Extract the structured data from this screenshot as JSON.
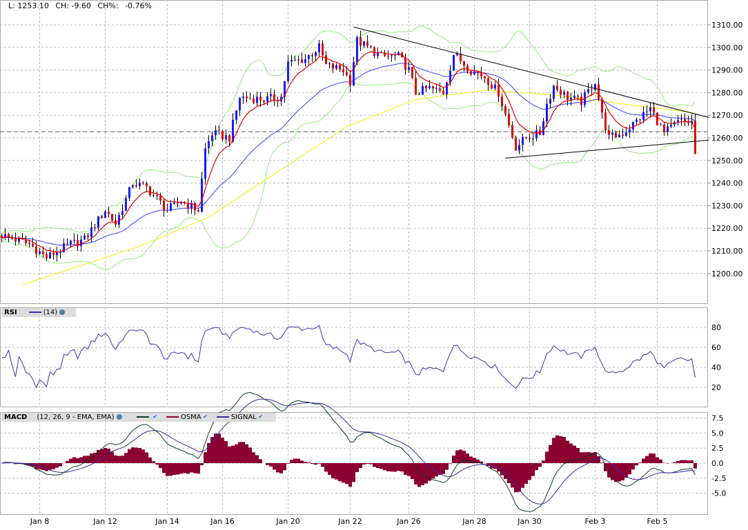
{
  "header": {
    "last": "L: 1253.10",
    "change": "CH: -9.60",
    "change_pct_label": "CH%:",
    "change_pct": "-0.76%"
  },
  "rsi_legend": {
    "name": "RSI",
    "param": "(14)"
  },
  "macd_legend": {
    "name": "MACD",
    "param": "(12, 26, 9 - EMA, EMA)",
    "osma": "OSMA",
    "signal": "SIGNAL"
  },
  "colors": {
    "up": "#1a1aff",
    "down": "#e00000",
    "ema_fast": "#e00000",
    "ema_slow": "#3b3bff",
    "bollinger": "#8cf07a",
    "sma_long": "#f2f23a",
    "rsi": "#4a2bb0",
    "macd": "#0d3b2a",
    "signal": "#3a2aa0",
    "osma": "#8b0030",
    "trend": "#000000"
  },
  "chart_data": {
    "type": "candlestick",
    "x_unit": "bar index",
    "price_axis": {
      "ticks": [
        "1310.00",
        "1300.00",
        "1290.00",
        "1280.00",
        "1270.00",
        "1260.00",
        "1250.00",
        "1240.00",
        "1230.00",
        "1220.00",
        "1210.00",
        "1200.00"
      ],
      "range": [
        1190,
        1316
      ]
    },
    "previous_close": 1262.7,
    "price_keypoints": [
      [
        0,
        1217
      ],
      [
        8,
        1213
      ],
      [
        13,
        1207
      ],
      [
        20,
        1213
      ],
      [
        24,
        1215
      ],
      [
        30,
        1228
      ],
      [
        33,
        1222
      ],
      [
        38,
        1240
      ],
      [
        42,
        1238
      ],
      [
        48,
        1228
      ],
      [
        52,
        1232
      ],
      [
        57,
        1228
      ],
      [
        59,
        1255
      ],
      [
        61,
        1262
      ],
      [
        66,
        1260
      ],
      [
        69,
        1278
      ],
      [
        76,
        1277
      ],
      [
        81,
        1278
      ],
      [
        83,
        1293
      ],
      [
        88,
        1295
      ],
      [
        92,
        1300
      ],
      [
        94,
        1292
      ],
      [
        99,
        1290
      ],
      [
        101,
        1285
      ],
      [
        103,
        1303
      ],
      [
        106,
        1300
      ],
      [
        110,
        1296
      ],
      [
        115,
        1296
      ],
      [
        118,
        1290
      ],
      [
        120,
        1280
      ],
      [
        124,
        1282
      ],
      [
        128,
        1280
      ],
      [
        131,
        1297
      ],
      [
        136,
        1290
      ],
      [
        140,
        1287
      ],
      [
        144,
        1280
      ],
      [
        149,
        1256
      ],
      [
        152,
        1260
      ],
      [
        156,
        1262
      ],
      [
        158,
        1275
      ],
      [
        160,
        1283
      ],
      [
        164,
        1278
      ],
      [
        168,
        1276
      ],
      [
        172,
        1285
      ],
      [
        174,
        1270
      ],
      [
        176,
        1260
      ],
      [
        180,
        1262
      ],
      [
        188,
        1273
      ],
      [
        192,
        1262
      ],
      [
        196,
        1267
      ],
      [
        200,
        1267
      ],
      [
        201,
        1253
      ]
    ],
    "sma_long_keypoints": [
      [
        6,
        1195
      ],
      [
        40,
        1212
      ],
      [
        60,
        1225
      ],
      [
        80,
        1245
      ],
      [
        100,
        1265
      ],
      [
        120,
        1277
      ],
      [
        140,
        1281
      ],
      [
        160,
        1279
      ],
      [
        180,
        1275
      ],
      [
        201,
        1271
      ]
    ],
    "upper_trendline": [
      [
        102,
        1309
      ],
      [
        205,
        1269
      ]
    ],
    "lower_trendline": [
      [
        146,
        1251
      ],
      [
        205,
        1259
      ]
    ],
    "rsi_axis": {
      "ticks": [
        "80",
        "60",
        "40",
        "20"
      ],
      "range": [
        0,
        100
      ]
    },
    "macd_axis": {
      "ticks": [
        "7.5",
        "5.0",
        "2.5",
        "0.0",
        "-2.5",
        "-5.0"
      ],
      "range": [
        -8,
        8.5
      ]
    },
    "x_labels": [
      {
        "label": "Jan 8",
        "bar": 11
      },
      {
        "label": "Jan 12",
        "bar": 30
      },
      {
        "label": "Jan 14",
        "bar": 48
      },
      {
        "label": "Jan 16",
        "bar": 64
      },
      {
        "label": "Jan 20",
        "bar": 83
      },
      {
        "label": "Jan 22",
        "bar": 101
      },
      {
        "label": "Jan 26",
        "bar": 118
      },
      {
        "label": "Jan 28",
        "bar": 137
      },
      {
        "label": "Jan 30",
        "bar": 153
      },
      {
        "label": "Feb 3",
        "bar": 172
      },
      {
        "label": "Feb 5",
        "bar": 190
      }
    ]
  }
}
